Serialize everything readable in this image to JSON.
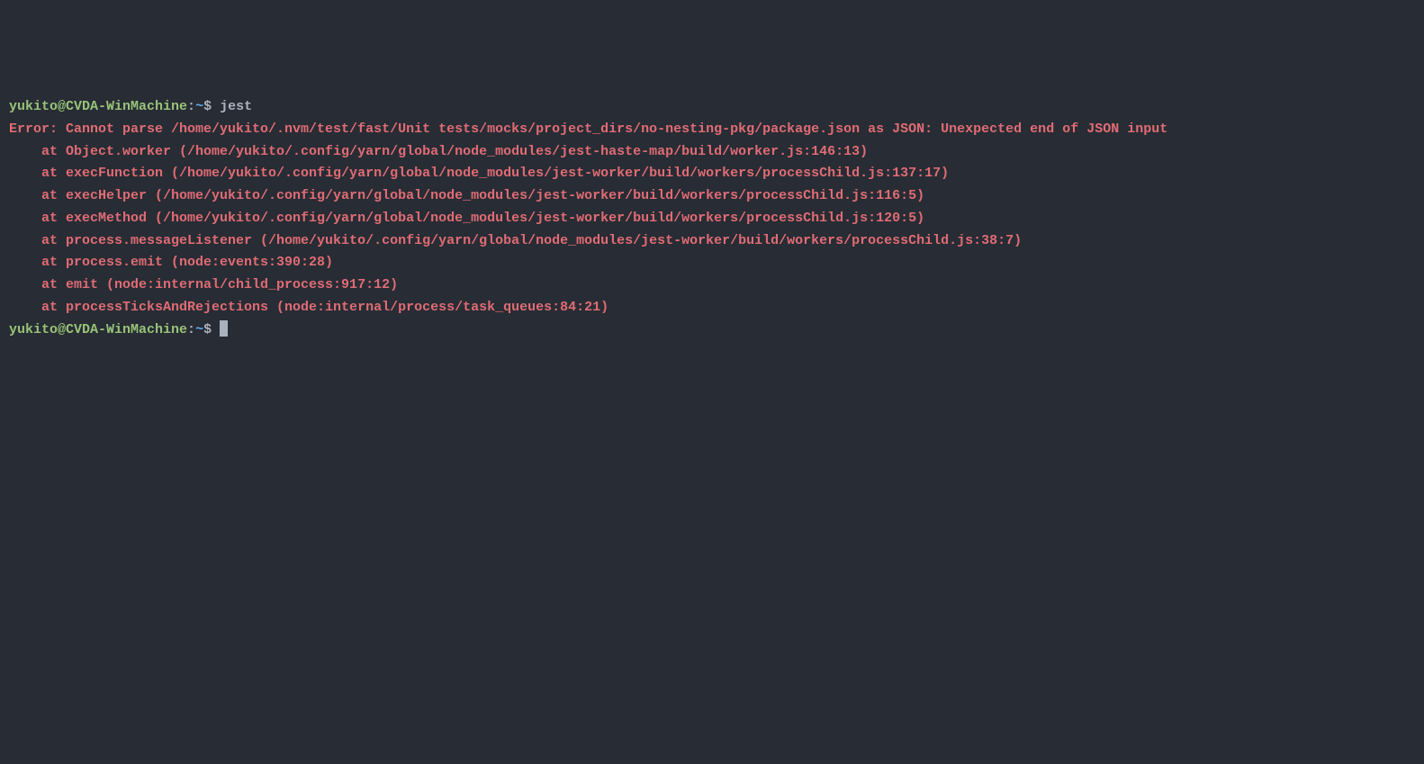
{
  "prompt1": {
    "user_host": "yukito@CVDA-WinMachine",
    "sep1": ":",
    "path": "~",
    "dollar": "$ ",
    "command": "jest"
  },
  "error": {
    "header": "Error: Cannot parse /home/yukito/.nvm/test/fast/Unit tests/mocks/project_dirs/no-nesting-pkg/package.json as JSON: Unexpected end of JSON input",
    "stack": [
      "    at Object.worker (/home/yukito/.config/yarn/global/node_modules/jest-haste-map/build/worker.js:146:13)",
      "    at execFunction (/home/yukito/.config/yarn/global/node_modules/jest-worker/build/workers/processChild.js:137:17)",
      "    at execHelper (/home/yukito/.config/yarn/global/node_modules/jest-worker/build/workers/processChild.js:116:5)",
      "    at execMethod (/home/yukito/.config/yarn/global/node_modules/jest-worker/build/workers/processChild.js:120:5)",
      "    at process.messageListener (/home/yukito/.config/yarn/global/node_modules/jest-worker/build/workers/processChild.js:38:7)",
      "    at process.emit (node:events:390:28)",
      "    at emit (node:internal/child_process:917:12)",
      "    at processTicksAndRejections (node:internal/process/task_queues:84:21)"
    ]
  },
  "prompt2": {
    "user_host": "yukito@CVDA-WinMachine",
    "sep1": ":",
    "path": "~",
    "dollar": "$ "
  }
}
